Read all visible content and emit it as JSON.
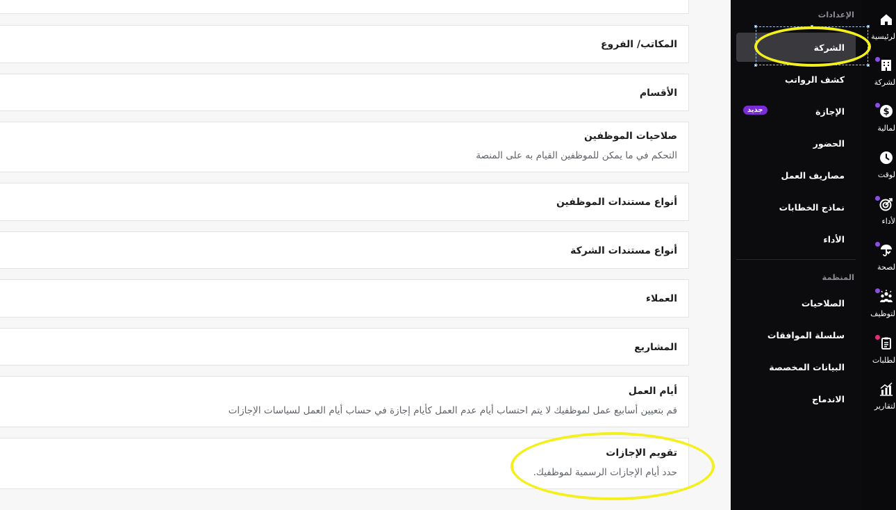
{
  "main": {
    "cards": [
      {
        "title": "المكاتب/ الفروع"
      },
      {
        "title": "الأقسام"
      },
      {
        "title": "صلاحيات الموظفين",
        "desc": "التحكم في ما يمكن للموظفين القيام به على المنصة"
      },
      {
        "title": "أنواع مستندات الموظفين"
      },
      {
        "title": "أنواع مستندات الشركة"
      },
      {
        "title": "العملاء"
      },
      {
        "title": "المشاريع"
      },
      {
        "title": "أيام العمل",
        "desc": "قم بتعيين أسابيع عمل لموظفيك لا يتم احتساب أيام عدم العمل كأيام إجازة في حساب أيام العمل لسياسات الإجازات"
      },
      {
        "title": "تقويم الإجازات",
        "desc": "حدد أيام الإجازات الرسمية لموظفيك."
      }
    ]
  },
  "settings_sidebar": {
    "section_settings": "الإعدادات",
    "items": [
      {
        "label": "الشركة",
        "active": true
      },
      {
        "label": "كشف الرواتب"
      },
      {
        "label": "الإجازة",
        "badge": "جديد"
      },
      {
        "label": "الحضور"
      },
      {
        "label": "مصاريف العمل"
      },
      {
        "label": "نماذج الخطابات"
      },
      {
        "label": "الأداء"
      }
    ],
    "section_organization": "المنظمة",
    "org_items": [
      {
        "label": "الصلاحيات"
      },
      {
        "label": "سلسلة الموافقات"
      },
      {
        "label": "البيانات المخصصة"
      },
      {
        "label": "الاندماج"
      }
    ]
  },
  "icon_rail": {
    "items": [
      {
        "label": "الرئيسية",
        "icon": "home-icon"
      },
      {
        "label": "الشركة",
        "icon": "building-icon",
        "dot": "#8a4fe0"
      },
      {
        "label": "المالية",
        "icon": "dollar-icon",
        "dot": "#8a4fe0"
      },
      {
        "label": "الوقت",
        "icon": "clock-icon"
      },
      {
        "label": "الأداء",
        "icon": "target-icon",
        "dot": "#8a4fe0"
      },
      {
        "label": "الصحة",
        "icon": "health-umbrella-icon",
        "dot": "#8a4fe0"
      },
      {
        "label": "التوظيف",
        "icon": "team-icon",
        "dot": "#8a4fe0"
      },
      {
        "label": "الطلبات",
        "icon": "clipboard-icon",
        "dot": "#e0307a"
      },
      {
        "label": "التقارير",
        "icon": "chart-icon"
      }
    ]
  },
  "colors": {
    "sidebar_bg": "#0c0c0e",
    "active_item_bg": "#3a3a3e",
    "badge_bg": "#7b2cd6",
    "annotation_ring": "#f4ef1e"
  }
}
